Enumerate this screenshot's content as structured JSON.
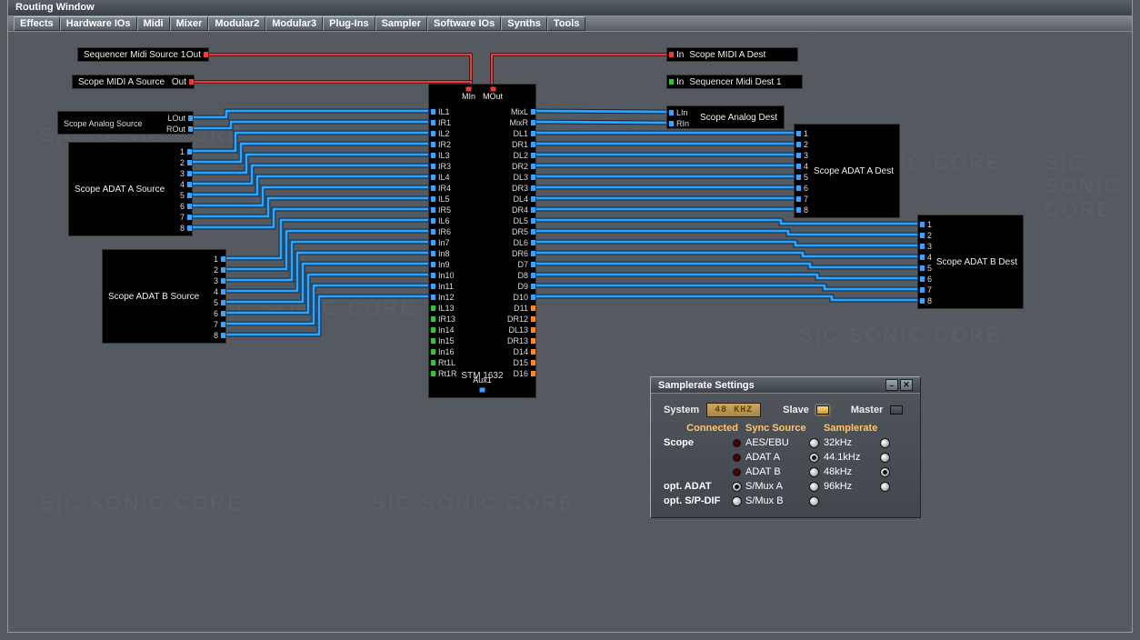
{
  "window_title": "Routing Window",
  "menu": [
    "Effects",
    "Hardware IOs",
    "Midi",
    "Mixer",
    "Modular2",
    "Modular3",
    "Plug-Ins",
    "Sampler",
    "Software IOs",
    "Synths",
    "Tools"
  ],
  "watermarks": [
    "S|C  SONIC CORE"
  ],
  "nodes": {
    "seq_midi_src": {
      "label": "Sequencer Midi Source 1",
      "port": "Out"
    },
    "scope_midi_src": {
      "label": "Scope MIDI A Source",
      "port": "Out"
    },
    "scope_midi_dest": {
      "port": "In",
      "label": "Scope MIDI A Dest"
    },
    "seq_midi_dest": {
      "port": "In",
      "label": "Sequencer Midi Dest 1"
    },
    "analog_src": {
      "label": "Scope Analog Source",
      "ports": [
        "LOut",
        "ROut"
      ]
    },
    "analog_dest": {
      "label": "Scope Analog Dest",
      "ports": [
        "LIn",
        "RIn"
      ]
    },
    "adat_a_src": {
      "label": "Scope ADAT A Source",
      "ports": [
        "1",
        "2",
        "3",
        "4",
        "5",
        "6",
        "7",
        "8"
      ]
    },
    "adat_b_src": {
      "label": "Scope ADAT B Source",
      "ports": [
        "1",
        "2",
        "3",
        "4",
        "5",
        "6",
        "7",
        "8"
      ]
    },
    "adat_a_dest": {
      "label": "Scope ADAT A Dest",
      "ports": [
        "1",
        "2",
        "3",
        "4",
        "5",
        "6",
        "7",
        "8"
      ]
    },
    "adat_b_dest": {
      "label": "Scope ADAT B Dest",
      "ports": [
        "1",
        "2",
        "3",
        "4",
        "5",
        "6",
        "7",
        "8"
      ]
    },
    "stm": {
      "title": "STM 1632",
      "top": {
        "min": "MIn",
        "mout": "MOut"
      },
      "aux": "Aux1",
      "left": [
        "IL1",
        "IR1",
        "IL2",
        "IR2",
        "IL3",
        "IR3",
        "IL4",
        "IR4",
        "IL5",
        "IR5",
        "IL6",
        "IR6",
        "In7",
        "In8",
        "In9",
        "In10",
        "In11",
        "In12",
        "IL13",
        "IR13",
        "In14",
        "In15",
        "In16",
        "Rt1L",
        "Rt1R"
      ],
      "left_colors": [
        "b",
        "b",
        "b",
        "b",
        "b",
        "b",
        "b",
        "b",
        "b",
        "b",
        "b",
        "b",
        "b",
        "b",
        "b",
        "b",
        "b",
        "b",
        "g",
        "g",
        "g",
        "g",
        "g",
        "g",
        "g"
      ],
      "right": [
        "MixL",
        "MixR",
        "DL1",
        "DR1",
        "DL2",
        "DR2",
        "DL3",
        "DR3",
        "DL4",
        "DR4",
        "DL5",
        "DR5",
        "DL6",
        "DR6",
        "D7",
        "D8",
        "D9",
        "D10",
        "D11",
        "DR12",
        "DL13",
        "DR13",
        "D14",
        "D15",
        "D16"
      ],
      "right_colors": [
        "b",
        "b",
        "b",
        "b",
        "b",
        "b",
        "b",
        "b",
        "b",
        "b",
        "b",
        "b",
        "b",
        "b",
        "b",
        "b",
        "b",
        "b",
        "o",
        "o",
        "o",
        "o",
        "o",
        "o",
        "o"
      ]
    }
  },
  "popup": {
    "title": "Samplerate Settings",
    "system_label": "System",
    "system_value": "48 KHZ",
    "slave_label": "Slave",
    "master_label": "Master",
    "headers": [
      "Connected",
      "Sync Source",
      "Samplerate"
    ],
    "rows_left": [
      "Scope",
      "",
      "",
      "opt. ADAT",
      "opt. S/P-DIF"
    ],
    "sync_src": [
      "AES/EBU",
      "ADAT A",
      "ADAT B",
      "S/Mux A",
      "S/Mux B"
    ],
    "sync_sel": "ADAT A",
    "srates": [
      "32kHz",
      "44.1kHz",
      "48kHz",
      "96kHz"
    ],
    "srate_sel": "48kHz",
    "opt_sel": "opt. ADAT"
  }
}
